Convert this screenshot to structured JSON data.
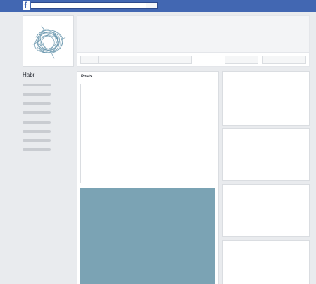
{
  "top_bar": {
    "logo_glyph": "f",
    "search": {
      "value": "",
      "placeholder": ""
    }
  },
  "page": {
    "name": "Habr",
    "left_nav_item_count": 8
  },
  "posts": {
    "title": "Posts"
  },
  "colors": {
    "top_bar": "#4267b2",
    "background": "#e9ebee",
    "placeholder_line": "#c9ccd1",
    "post_image": "#7ba3b4",
    "avatar_scribble": "#6f9ab0"
  },
  "icons": [
    "facebook-logo-icon",
    "scribble-ball-avatar"
  ]
}
